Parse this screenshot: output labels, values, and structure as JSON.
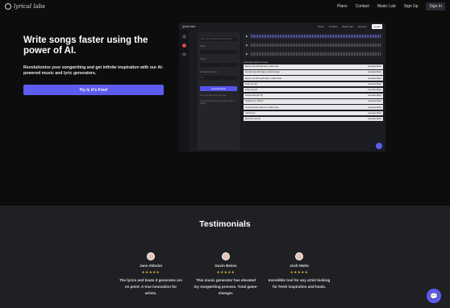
{
  "nav": {
    "logo": "lyrical labs",
    "links": [
      "Plans",
      "Contact",
      "Music Lab",
      "Sign Up"
    ],
    "signin": "Sign In"
  },
  "hero": {
    "title": "Write songs faster using the power of AI.",
    "subtitle": "Revolutionize your songwriting and get infinite inspiration with our AI-powered music and lyric generators.",
    "cta": "Try it, it's Free!"
  },
  "preview": {
    "logo": "lyrical labs",
    "links": [
      "Plans",
      "Contact",
      "Music Lab",
      "Account"
    ],
    "login": "Logout",
    "form": {
      "prompt_placeholder": "Enter your add favorite instruments",
      "genre_label": "Genre",
      "mood_label": "Tempo",
      "bpm_label": "Duration (seconds)",
      "duration_value": "30",
      "generate": "Generate Music",
      "note1": "Pro required as long as below",
      "note2": "Total generations left for today to be 6 Adkins"
    },
    "section_title": "Generated Music Tracks",
    "tracks": [
      {
        "name": "Electric pop with fast beat, modern feel",
        "action": "Generate Music",
        "dark": false
      },
      {
        "name": "Acoustic pop with happy vocals (female)",
        "action": "Generate Music",
        "dark": false
      },
      {
        "name": "Electric pop with synth loops, modern beat",
        "action": "Generate Music",
        "dark": false
      },
      {
        "name": "Funky pop (6)",
        "action": "Generate Music",
        "dark": false
      },
      {
        "name": "Funky pop (4)",
        "action": "Generate Music",
        "dark": false
      },
      {
        "name": "Instrumental jazz (3)",
        "action": "Generate Music",
        "dark": false
      },
      {
        "name": "Ambient lo-fi, chill (2)",
        "action": "Generate Music",
        "dark": false
      },
      {
        "name": "Funky pop with Indie feel, modern beat",
        "action": "Generate Music",
        "dark": false
      },
      {
        "name": "Lofi hip hop",
        "action": "Generate Music",
        "dark": false
      },
      {
        "name": "Electronic pop (1)",
        "action": "Generate Music",
        "dark": false
      }
    ]
  },
  "testimonials": {
    "title": "Testimonials",
    "items": [
      {
        "name": "Jane Akbulut",
        "stars": "★★★★★",
        "quote": "The lyrics and beats it generates are on point. A true innovation for artists."
      },
      {
        "name": "Gavin Beims",
        "stars": "★★★★★",
        "quote": "This music generator has elevated my songwriting process. Total game-changer."
      },
      {
        "name": "Josh Watts",
        "stars": "★★★★★",
        "quote": "Incredible tool for any artist looking for fresh inspiration and beats."
      }
    ]
  },
  "colors": {
    "accent": "#5c5cf0",
    "background": "#0d0d0e",
    "testimonials_bg": "#1f2024",
    "star": "#e4b53a"
  },
  "icons": {
    "chat": "chat-bubble-icon",
    "logo": "lyrical-labs-logo-icon"
  }
}
